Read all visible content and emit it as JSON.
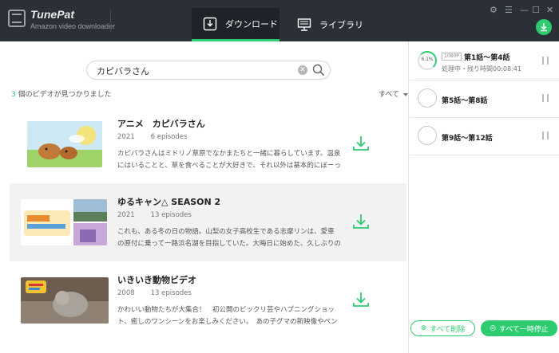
{
  "app": {
    "name": "TunePat",
    "subtitle": "Amazon video downloader"
  },
  "tabs": [
    {
      "label": "ダウンロード",
      "active": true
    },
    {
      "label": "ライブラリ",
      "active": false
    }
  ],
  "window_controls": [
    "settings-icon",
    "menu-icon",
    "minimize-icon",
    "maximize-icon",
    "close-icon"
  ],
  "search": {
    "value": "カピバラさん",
    "placeholder": ""
  },
  "results": {
    "count": "3",
    "text": " 個のビデオが見つかりました",
    "sort_label": "すべて"
  },
  "items": [
    {
      "title": "アニメ　カピバラさん",
      "year": "2021",
      "episodes": "6 episodes",
      "description": "カピバラさんはミドリノ草原でなかまたちと一緒に暮らしています。温泉にはいることと、草を食べることが大好きで、それ以外は基本的にぼーっと..."
    },
    {
      "title": "ゆるキャン△ SEASON 2",
      "year": "2021",
      "episodes": "13 episodes",
      "description": "これも、ある冬の日の物語。山梨の女子高校生である志摩リンは、愛車の原付に乗って一路浜名湖を目指していた。大晦日に始めた、久しぶりのソロ..."
    },
    {
      "title": "いきいき動物ビデオ",
      "year": "2008",
      "episodes": "13 episodes",
      "description": "かわいい動物たちが大集合！　初公開のビックリ芸やハプニングショット、癒しのワンシーンをお楽しみください。　あの子グマの新映像やペンギ..."
    }
  ],
  "queue": [
    {
      "badge": "1080P",
      "title": "第1話～第4話",
      "status": "処理中・残り時間00:08:41",
      "progress": "6.1%"
    },
    {
      "badge": "",
      "title": "第5話～第8話",
      "status": "",
      "progress": ""
    },
    {
      "badge": "",
      "title": "第9話～第12話",
      "status": "",
      "progress": ""
    }
  ],
  "buttons": {
    "clear_all": "すべて削除",
    "pause_all": "すべて一時停止"
  },
  "colors": {
    "accent": "#2ecc71",
    "titlebar": "#2b2f36"
  }
}
